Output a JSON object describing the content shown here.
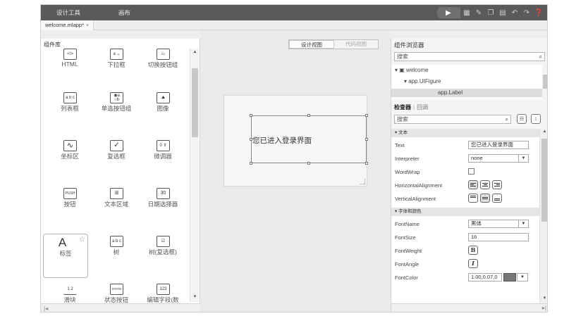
{
  "menus": [
    "设计工具",
    "画布"
  ],
  "file_tab": {
    "name": "welcome.mlapp*",
    "close": "×"
  },
  "toolbar_icons": [
    "run-icon",
    "save-icon",
    "pen-icon",
    "copy-icon",
    "paste-icon",
    "undo-icon",
    "redo-icon",
    "help-icon"
  ],
  "library": {
    "title": "组件库",
    "items": [
      {
        "label": "HTML",
        "icon": "html-icon",
        "glyph": "</>"
      },
      {
        "label": "下拉框",
        "icon": "dropdown-icon",
        "glyph": "a ⌄"
      },
      {
        "label": "切换按钮组",
        "icon": "toggle-group-icon",
        "glyph": "▭"
      },
      {
        "label": "列表框",
        "icon": "listbox-icon",
        "glyph": "a b c"
      },
      {
        "label": "单选按钮组",
        "icon": "radio-group-icon",
        "glyph": "◉a ○b"
      },
      {
        "label": "图像",
        "icon": "image-icon",
        "glyph": "⛰"
      },
      {
        "label": "坐标区",
        "icon": "axes-icon",
        "glyph": "∿"
      },
      {
        "label": "复选框",
        "icon": "checkbox-icon",
        "glyph": "✓"
      },
      {
        "label": "微调器",
        "icon": "spinner-icon",
        "glyph": "0 ⇕"
      },
      {
        "label": "按钮",
        "icon": "push-button-icon",
        "glyph": "PUSH"
      },
      {
        "label": "文本区域",
        "icon": "text-area-icon",
        "glyph": "≡"
      },
      {
        "label": "日期选择器",
        "icon": "date-picker-icon",
        "glyph": "30"
      },
      {
        "label": "标签",
        "icon": "label-icon",
        "glyph": "A"
      },
      {
        "label": "树",
        "icon": "tree-icon",
        "glyph": "a b c"
      },
      {
        "label": "树(复选框)",
        "icon": "checkbox-tree-icon",
        "glyph": "☑"
      },
      {
        "label": "滑块",
        "icon": "slider-icon",
        "glyph": "1 2"
      },
      {
        "label": "状态按钮",
        "icon": "state-button-icon",
        "glyph": "STATE"
      },
      {
        "label": "编辑字段(数",
        "icon": "numeric-field-icon",
        "glyph": "123"
      }
    ]
  },
  "canvas": {
    "view_design": "设计视图",
    "view_code": "代码视图",
    "label_text": "您已进入登录界面"
  },
  "browser": {
    "title": "组件浏览器",
    "search_placeholder": "搜索",
    "tree": [
      "welcome",
      "app.UIFigure",
      "app.Label"
    ]
  },
  "inspector": {
    "tab_inspector": "检查器",
    "tab_callback": "回调",
    "search_placeholder": "搜索",
    "section_text": "▾ 文本",
    "section_font": "▾ 字体和颜色",
    "props": {
      "text": {
        "name": "Text",
        "value": "您已进入登录界面"
      },
      "interpreter": {
        "name": "Interpreter",
        "value": "none"
      },
      "wordwrap": {
        "name": "WordWrap",
        "checked": false
      },
      "halign": {
        "name": "HorizontalAlignment",
        "value": "left"
      },
      "valign": {
        "name": "VerticalAlignment",
        "value": "center"
      },
      "fontname": {
        "name": "FontName",
        "value": "黑体"
      },
      "fontsize": {
        "name": "FontSize",
        "value": "16"
      },
      "fontweight": {
        "name": "FontWeight",
        "glyph": "B"
      },
      "fontangle": {
        "name": "FontAngle",
        "glyph": "I"
      },
      "fontcolor": {
        "name": "FontColor",
        "value": "1.00,0.07,0",
        "swatch": "#767676"
      }
    }
  }
}
